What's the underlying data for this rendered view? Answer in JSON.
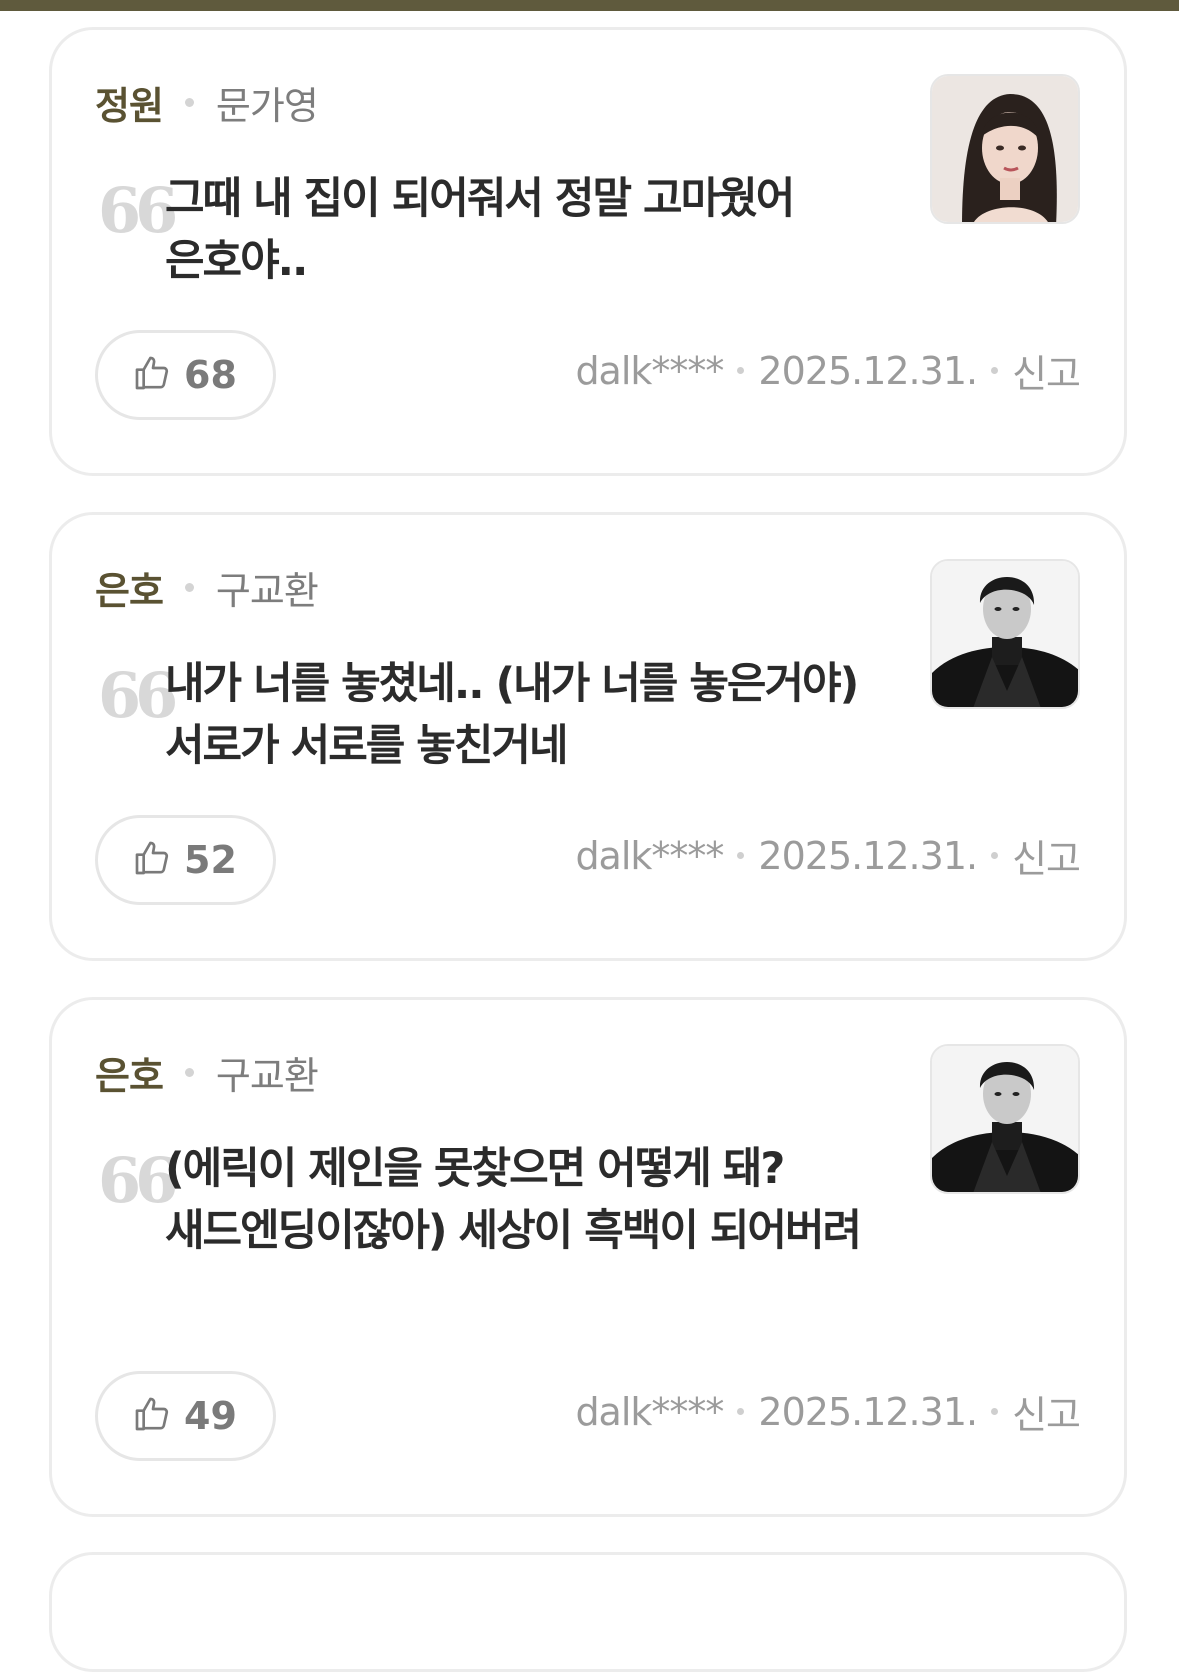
{
  "comments": [
    {
      "role": "정원",
      "actor": "문가영",
      "text": "그때 내 집이 되어줘서 정말 고마웠어 은호야..",
      "likes": "68",
      "user": "dalk****",
      "date": "2025.12.31.",
      "report": "신고",
      "photo_icon": "actress-photo"
    },
    {
      "role": "은호",
      "actor": "구교환",
      "text": "내가 너를 놓쳤네.. (내가 너를 놓은거야) 서로가 서로를 놓친거네",
      "likes": "52",
      "user": "dalk****",
      "date": "2025.12.31.",
      "report": "신고",
      "photo_icon": "actor-photo"
    },
    {
      "role": "은호",
      "actor": "구교환",
      "text": "(에릭이 제인을 못찾으면 어떻게 돼? 새드엔딩이잖아) 세상이 흑백이 되어버려",
      "likes": "49",
      "user": "dalk****",
      "date": "2025.12.31.",
      "report": "신고",
      "photo_icon": "actor-photo"
    }
  ],
  "quote_glyph": "66",
  "colors": {
    "accent": "#5a5232",
    "top_bar": "#5f5a3d",
    "text": "#2b2b2b",
    "muted": "#9b9b9b"
  }
}
